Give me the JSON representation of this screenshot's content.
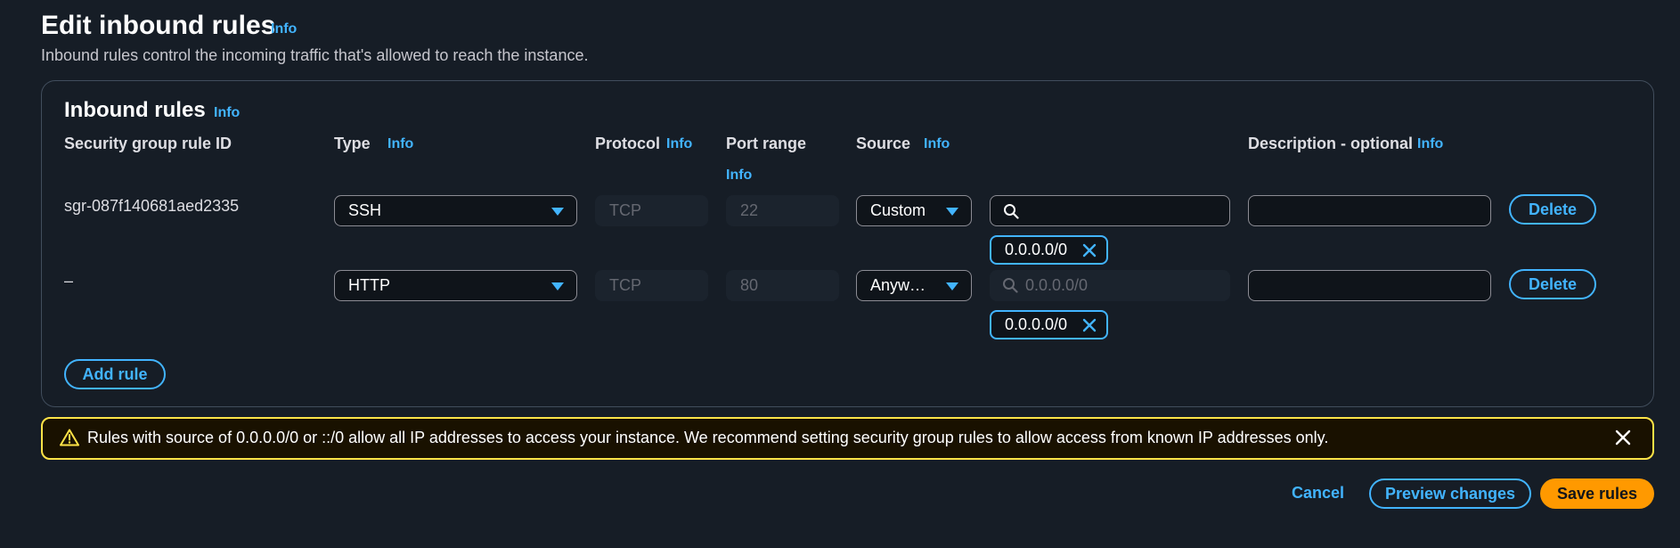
{
  "header": {
    "title": "Edit inbound rules",
    "info": "Info",
    "description": "Inbound rules control the incoming traffic that's allowed to reach the instance."
  },
  "panel": {
    "title": "Inbound rules",
    "info": "Info",
    "columns": {
      "rule_id": "Security group rule ID",
      "type": "Type",
      "type_info": "Info",
      "protocol": "Protocol",
      "protocol_info": "Info",
      "port_range": "Port range",
      "port_range_info": "Info",
      "source": "Source",
      "source_info": "Info",
      "description": "Description - optional",
      "description_info": "Info"
    },
    "rules": [
      {
        "rule_id": "sgr-087f140681aed2335",
        "type": "SSH",
        "protocol": "TCP",
        "port_range": "22",
        "source": "Custom",
        "search_placeholder": "",
        "cidr_token": "0.0.0.0/0",
        "description_value": "",
        "delete_label": "Delete"
      },
      {
        "rule_id": "–",
        "type": "HTTP",
        "protocol": "TCP",
        "port_range": "80",
        "source": "Anyw…",
        "search_placeholder": "0.0.0.0/0",
        "cidr_token": "0.0.0.0/0",
        "description_value": "",
        "delete_label": "Delete"
      }
    ],
    "add_rule_label": "Add rule"
  },
  "warning": {
    "text": "Rules with source of 0.0.0.0/0 or ::/0 allow all IP addresses to access your instance. We recommend setting security group rules to allow access from known IP addresses only.",
    "icon": "warning-triangle-icon",
    "close_icon": "close-icon"
  },
  "footer": {
    "cancel_label": "Cancel",
    "preview_label": "Preview changes",
    "save_label": "Save rules"
  },
  "colors": {
    "background": "#161d26",
    "accent": "#42b4ff",
    "primary_button": "#ff9900",
    "warning_border": "#ffe347"
  }
}
